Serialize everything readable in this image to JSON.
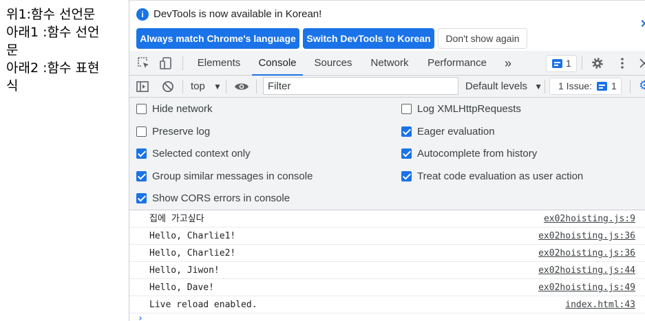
{
  "page": {
    "lines": [
      "위1:함수 선언문",
      "아래1 :함수 선언",
      "문",
      "아래2 :함수 표현",
      "식"
    ]
  },
  "infobar": {
    "message": "DevTools is now available in Korean!",
    "buttons": {
      "match": "Always match Chrome's language",
      "switch": "Switch DevTools to Korean",
      "dismiss": "Don't show again"
    }
  },
  "tabs": {
    "items": [
      "Elements",
      "Console",
      "Sources",
      "Network",
      "Performance"
    ],
    "active": "Console",
    "more": "»",
    "messages_count": "1"
  },
  "console_toolbar": {
    "context": "top",
    "filter_placeholder": "Filter",
    "levels": "Default levels",
    "issues_label": "1 Issue:",
    "issues_count": "1"
  },
  "settings": {
    "left": [
      {
        "label": "Hide network",
        "checked": false
      },
      {
        "label": "Preserve log",
        "checked": false
      },
      {
        "label": "Selected context only",
        "checked": true
      },
      {
        "label": "Group similar messages in console",
        "checked": true
      },
      {
        "label": "Show CORS errors in console",
        "checked": true
      }
    ],
    "right": [
      {
        "label": "Log XMLHttpRequests",
        "checked": false
      },
      {
        "label": "Eager evaluation",
        "checked": true
      },
      {
        "label": "Autocomplete from history",
        "checked": true
      },
      {
        "label": "Treat code evaluation as user action",
        "checked": true
      }
    ]
  },
  "messages": [
    {
      "text": "집에 가고싶다",
      "source": "ex02hoisting.js:9"
    },
    {
      "text": "Hello, Charlie1!",
      "source": "ex02hoisting.js:36"
    },
    {
      "text": "Hello, Charlie2!",
      "source": "ex02hoisting.js:36"
    },
    {
      "text": "Hello, Jiwon!",
      "source": "ex02hoisting.js:44"
    },
    {
      "text": "Hello, Dave!",
      "source": "ex02hoisting.js:49"
    },
    {
      "text": "Live reload enabled.",
      "source": "index.html:43"
    }
  ],
  "colors": {
    "accent": "#1a73e8",
    "toolbar_bg": "#f1f3f4"
  }
}
